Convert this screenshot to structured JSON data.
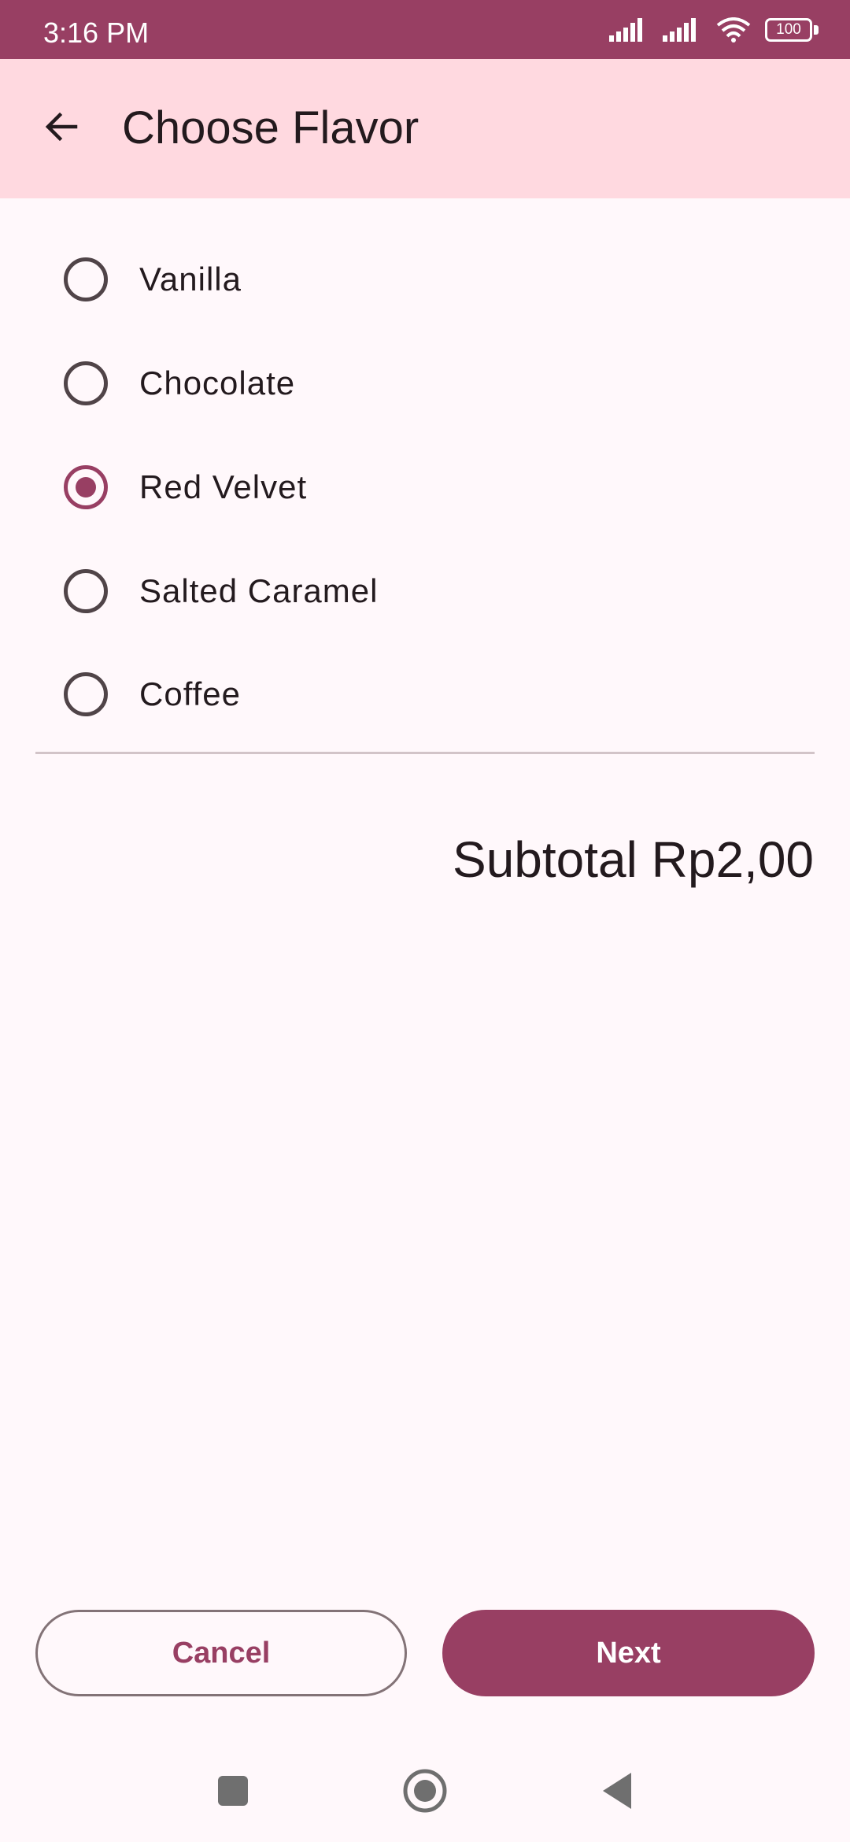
{
  "status_bar": {
    "time": "3:16 PM",
    "battery": "100",
    "icons": [
      "signal-icon",
      "signal-icon",
      "wifi-icon",
      "battery-icon"
    ],
    "color": "#983f63"
  },
  "app_bar": {
    "title": "Choose Flavor",
    "back_icon": "arrow-back-icon",
    "color": "#ffd9e0"
  },
  "options": [
    {
      "label": "Vanilla",
      "selected": false
    },
    {
      "label": "Chocolate",
      "selected": false
    },
    {
      "label": "Red Velvet",
      "selected": true
    },
    {
      "label": "Salted Caramel",
      "selected": false
    },
    {
      "label": "Coffee",
      "selected": false
    }
  ],
  "subtotal": "Subtotal Rp2,00",
  "buttons": {
    "cancel": "Cancel",
    "next": "Next"
  },
  "nav_bar": {
    "icons": [
      "recents-square-icon",
      "home-circle-icon",
      "back-triangle-icon"
    ]
  },
  "colors": {
    "accent": "#983f63",
    "background": "#fff8fb"
  }
}
